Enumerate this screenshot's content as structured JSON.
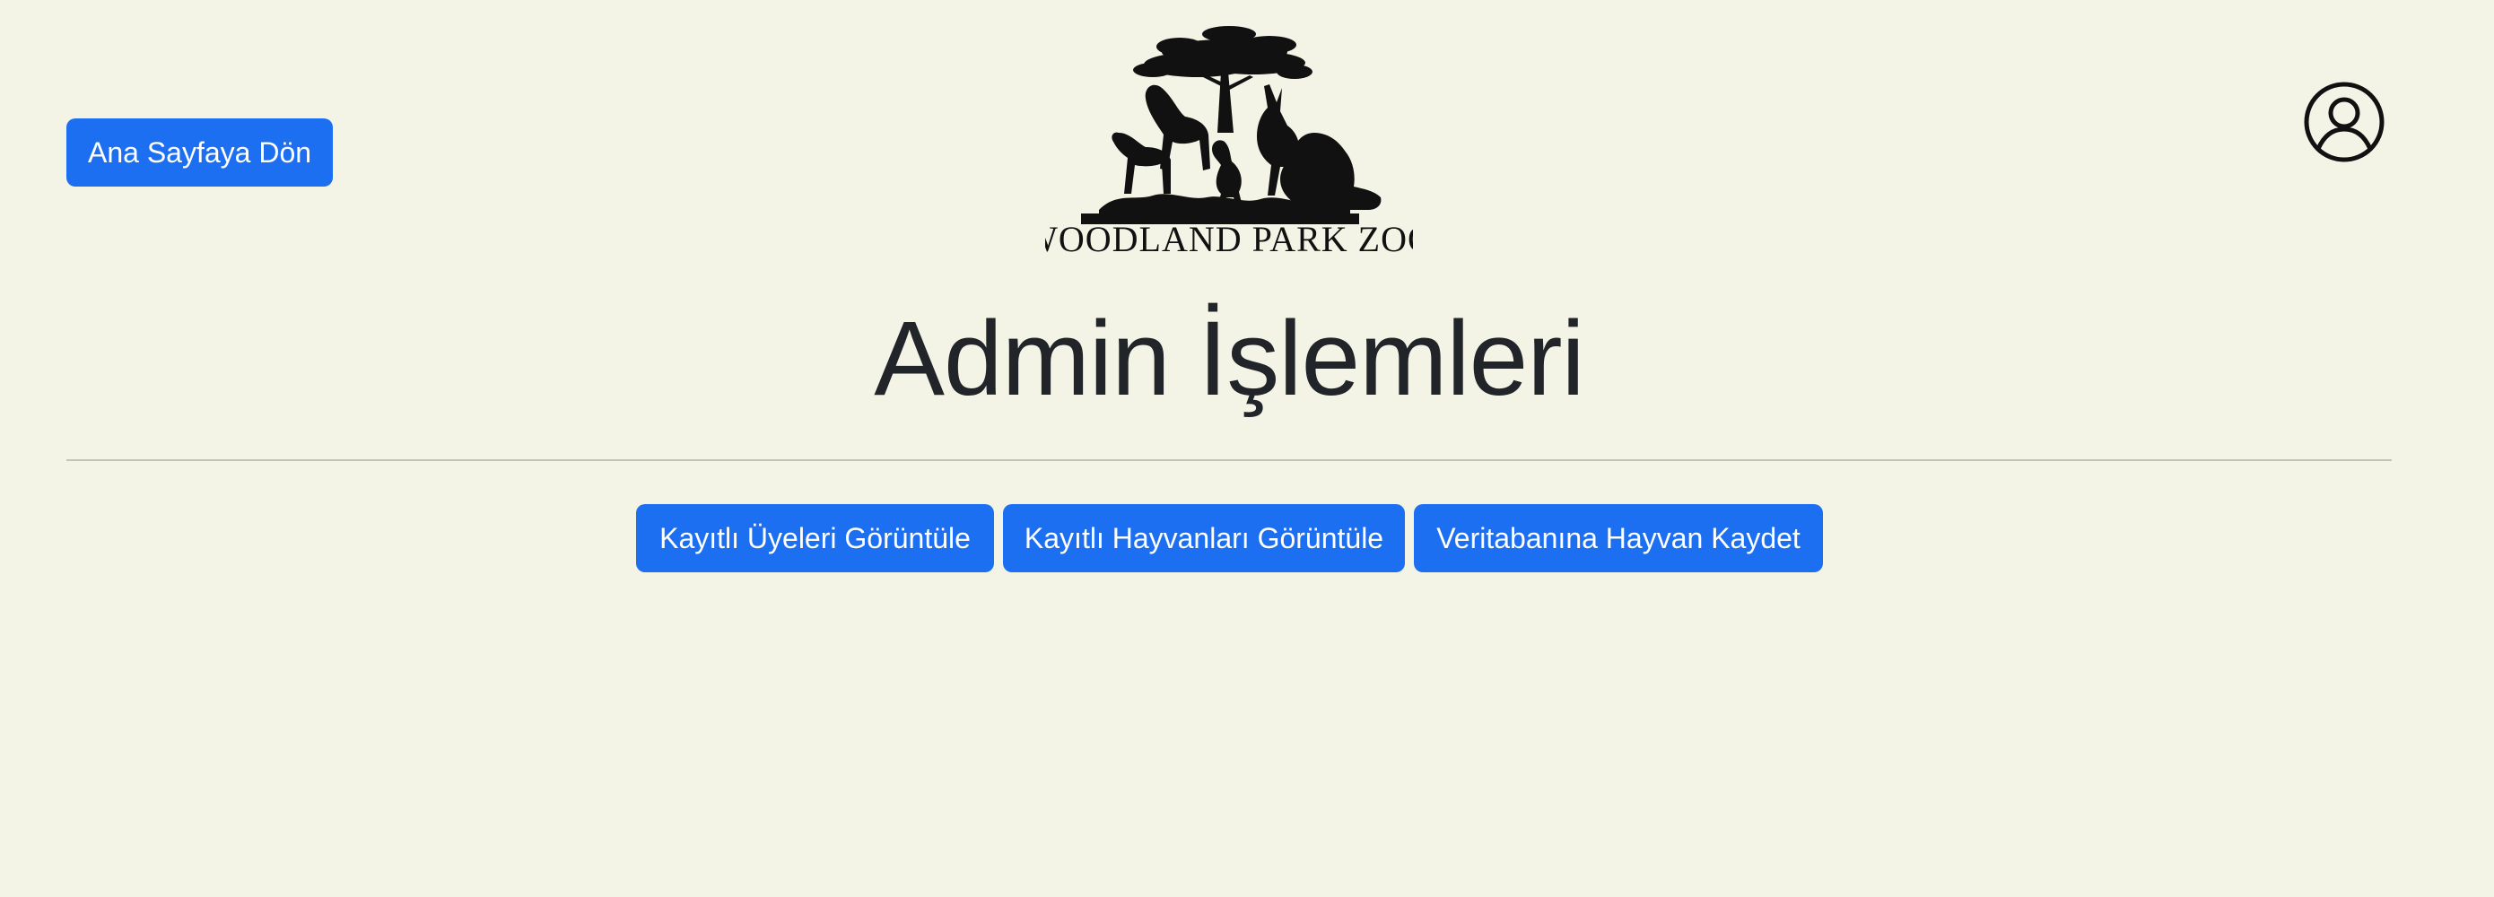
{
  "header": {
    "back_label": "Ana Sayfaya Dön",
    "logo_text": "WOODLAND PARK ZOO",
    "logo_icon": "zoo-logo-tree-animals",
    "profile_icon": "user-circle-icon"
  },
  "main": {
    "title": "Admin İşlemleri",
    "actions": [
      {
        "label": "Kayıtlı Üyeleri Görüntüle"
      },
      {
        "label": "Kayıtlı Hayvanları Görüntüle"
      },
      {
        "label": "Veritabanına Hayvan Kaydet"
      }
    ]
  },
  "colors": {
    "background": "#f4f4e6",
    "accent": "#1d6ff2",
    "text": "#212529",
    "divider": "#c3c3b8"
  }
}
